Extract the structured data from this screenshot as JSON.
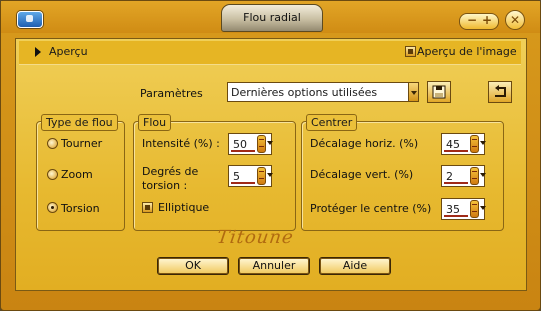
{
  "window": {
    "title": "Flou radial"
  },
  "preview": {
    "label": "Aperçu",
    "image_preview_label": "Aperçu de l'image",
    "image_preview_checked": true
  },
  "params": {
    "label": "Paramètres",
    "preset_value": "Dernières options utilisées"
  },
  "blur_type": {
    "title": "Type de flou",
    "options": [
      {
        "label": "Tourner",
        "selected": false
      },
      {
        "label": "Zoom",
        "selected": false
      },
      {
        "label": "Torsion",
        "selected": true
      }
    ]
  },
  "blur": {
    "title": "Flou",
    "intensity_label": "Intensité (%) :",
    "intensity_value": "50",
    "torsion_label_1": "Degrés de",
    "torsion_label_2": "torsion :",
    "torsion_value": "5",
    "elliptical_label": "Elliptique",
    "elliptical_checked": true
  },
  "center": {
    "title": "Centrer",
    "h_offset_label": "Décalage horiz. (%)",
    "h_offset_value": "45",
    "v_offset_label": "Décalage vert. (%)",
    "v_offset_value": "2",
    "protect_label": "Protéger le centre (%)",
    "protect_value": "35"
  },
  "signature": "Titoune",
  "buttons": {
    "ok": "OK",
    "cancel": "Annuler",
    "help": "Aide"
  },
  "colors": {
    "frame": "#d08c14",
    "panel": "#e7b930",
    "accent": "#b06a10"
  }
}
